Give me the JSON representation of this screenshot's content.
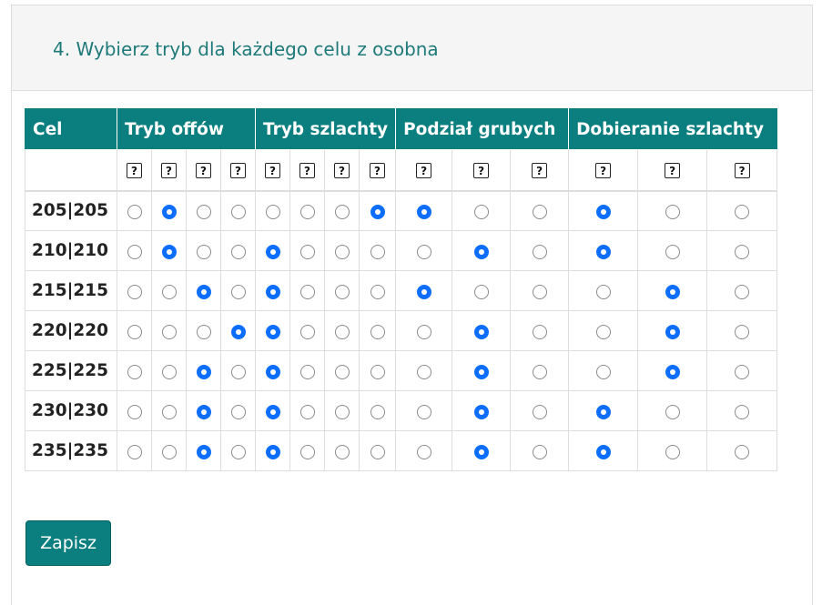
{
  "section": {
    "title": "4. Wybierz tryb dla każdego celu z osobna"
  },
  "table": {
    "target_header": "Cel",
    "groups": [
      {
        "label": "Tryb offów",
        "colspan": 4
      },
      {
        "label": "Tryb szlachty",
        "colspan": 4
      },
      {
        "label": "Podział grubych",
        "colspan": 3
      },
      {
        "label": "Dobieranie szlachty",
        "colspan": 3
      }
    ],
    "help_glyph": "?",
    "rows": [
      {
        "target": "205|205",
        "selected": [
          1,
          3,
          0,
          0
        ]
      },
      {
        "target": "210|210",
        "selected": [
          1,
          0,
          1,
          0
        ]
      },
      {
        "target": "215|215",
        "selected": [
          2,
          0,
          0,
          1
        ]
      },
      {
        "target": "220|220",
        "selected": [
          3,
          0,
          1,
          1
        ]
      },
      {
        "target": "225|225",
        "selected": [
          2,
          0,
          1,
          1
        ]
      },
      {
        "target": "230|230",
        "selected": [
          2,
          0,
          1,
          0
        ]
      },
      {
        "target": "235|235",
        "selected": [
          2,
          0,
          1,
          0
        ]
      }
    ]
  },
  "actions": {
    "save_label": "Zapisz"
  },
  "colors": {
    "accent": "#0b7f7f",
    "radio_checked": "#0d6efd",
    "title_text": "#1f7a7a"
  }
}
